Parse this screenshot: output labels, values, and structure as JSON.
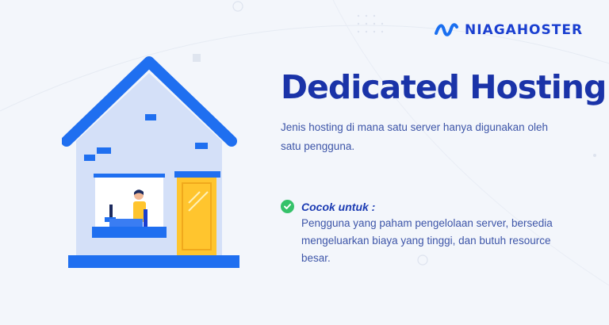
{
  "brand": {
    "name": "NIAGAHOSTER",
    "logo_icon": "niagahoster-wave-logo",
    "color": "#1a3fd0"
  },
  "hero": {
    "title": "Dedicated Hosting",
    "description": "Jenis hosting di mana satu server hanya digunakan oleh satu pengguna."
  },
  "suitable": {
    "label": "Cocok untuk :",
    "icon": "check-circle-icon",
    "text": "Pengguna yang paham pengelolaan server, bersedia mengeluarkan biaya yang tinggi, dan butuh resource besar."
  },
  "illustration": {
    "name": "house-with-person-at-computer"
  },
  "colors": {
    "background": "#f3f6fb",
    "title": "#1a33a8",
    "text": "#3d55a8",
    "check": "#35c26a",
    "roof": "#1f6ff0",
    "door": "#ffc52e"
  }
}
